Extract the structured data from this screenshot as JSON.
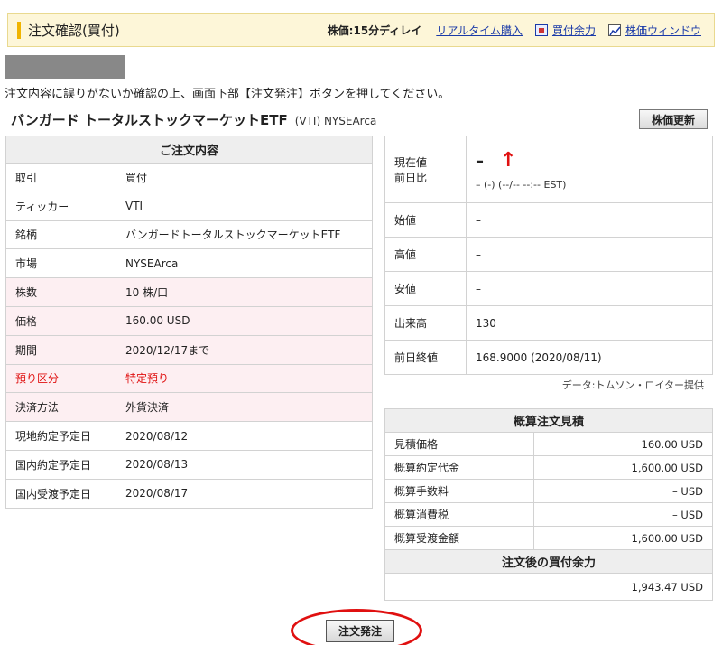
{
  "header": {
    "title": "注文確認(買付)",
    "delay": "株価:15分ディレイ",
    "realtime_link": "リアルタイム購入",
    "buying_power_link": "買付余力",
    "price_window_link": "株価ウィンドウ",
    "accent_color": "#f0b400"
  },
  "instruction": "注文内容に誤りがないか確認の上、画面下部【注文発注】ボタンを押してください。",
  "product": {
    "name": "バンガード トータルストックマーケットETF",
    "ticker_market": "(VTI) NYSEArca",
    "refresh_label": "株価更新"
  },
  "order": {
    "header": "ご注文内容",
    "rows": [
      {
        "label": "取引",
        "value": "買付"
      },
      {
        "label": "ティッカー",
        "value": "VTI"
      },
      {
        "label": "銘柄",
        "value": "バンガードトータルストックマーケットETF"
      },
      {
        "label": "市場",
        "value": "NYSEArca"
      },
      {
        "label": "株数",
        "value": "10 株/口"
      },
      {
        "label": "価格",
        "value": "160.00 USD"
      },
      {
        "label": "期間",
        "value": "2020/12/17まで"
      },
      {
        "label": "預り区分",
        "value": "特定預り"
      },
      {
        "label": "決済方法",
        "value": "外貨決済"
      },
      {
        "label": "現地約定予定日",
        "value": "2020/08/12"
      },
      {
        "label": "国内約定予定日",
        "value": "2020/08/13"
      },
      {
        "label": "国内受渡予定日",
        "value": "2020/08/17"
      }
    ]
  },
  "quote": {
    "current_label": "現在値",
    "change_label": "前日比",
    "current_value": "–",
    "arrow": "↑",
    "change_value": "– (-) (--/-- --:-- EST)",
    "open_label": "始値",
    "open_value": "–",
    "high_label": "高値",
    "high_value": "–",
    "low_label": "安値",
    "low_value": "–",
    "volume_label": "出来高",
    "volume_value": "130",
    "prev_close_label": "前日終値",
    "prev_close_value": "168.9000 (2020/08/11)"
  },
  "data_note": "データ:トムソン・ロイター提供",
  "estimate": {
    "header": "概算注文見積",
    "rows": [
      {
        "label": "見積価格",
        "value": "160.00 USD"
      },
      {
        "label": "概算約定代金",
        "value": "1,600.00 USD"
      },
      {
        "label": "概算手数料",
        "value": "– USD"
      },
      {
        "label": "概算消費税",
        "value": "– USD"
      },
      {
        "label": "概算受渡金額",
        "value": "1,600.00 USD"
      }
    ],
    "after_header": "注文後の買付余力",
    "after_value": "1,943.47 USD"
  },
  "submit_label": "注文発注",
  "highlight_color": "#e01010"
}
